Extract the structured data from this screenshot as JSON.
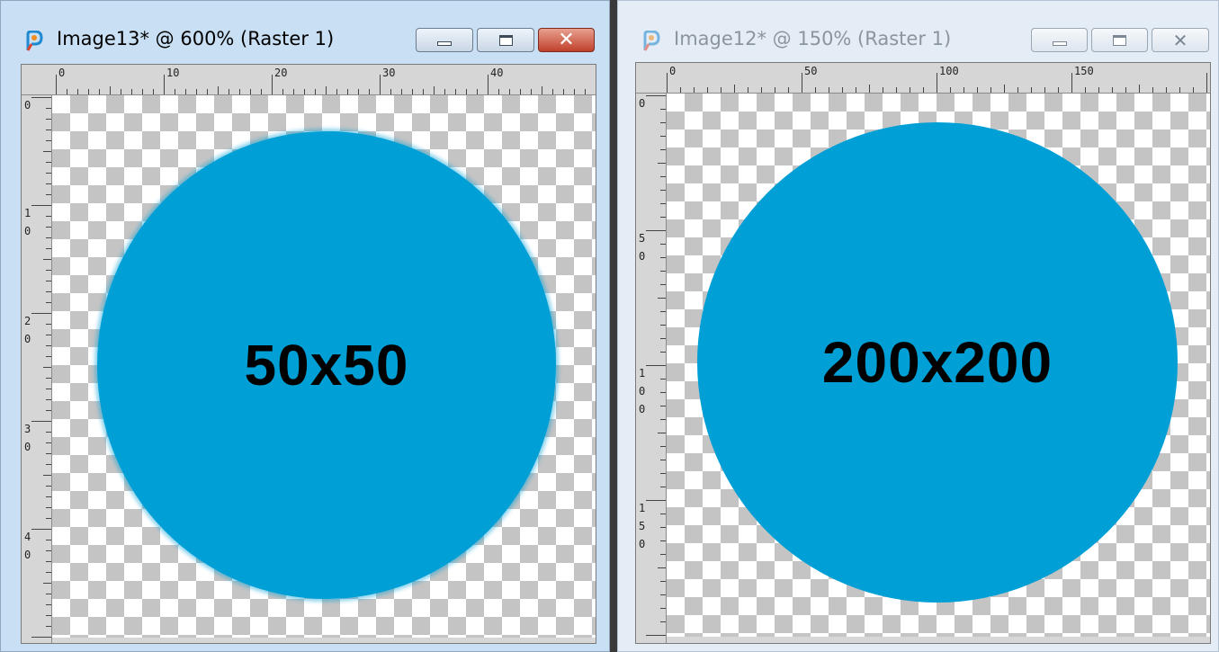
{
  "windows": [
    {
      "id": "left",
      "title": "Image13* @ 600% (Raster 1)",
      "active": true,
      "app_icon": "paintshop-pro-icon",
      "controls": {
        "minimize": "minimize-icon",
        "maximize": "maximize-icon",
        "close": "close-icon"
      },
      "h_ruler_labels": [
        "0",
        "10",
        "20",
        "30",
        "40"
      ],
      "v_ruler_labels": [
        [
          "0"
        ],
        [
          "1",
          "0"
        ],
        [
          "2",
          "0"
        ],
        [
          "3",
          "0"
        ],
        [
          "4",
          "0"
        ]
      ],
      "canvas_label": "50x50",
      "colors": {
        "circle": "#009fd6",
        "titlebar": "#c9dff3",
        "close_button": "#c0412c"
      }
    },
    {
      "id": "right",
      "title": "Image12* @ 150% (Raster 1)",
      "active": false,
      "app_icon": "paintshop-pro-icon",
      "controls": {
        "minimize": "minimize-icon",
        "maximize": "maximize-icon",
        "close": "close-icon"
      },
      "h_ruler_labels": [
        "0",
        "50",
        "100",
        "150"
      ],
      "v_ruler_labels": [
        [
          "0"
        ],
        [
          "5",
          "0"
        ],
        [
          "1",
          "0",
          "0"
        ],
        [
          "1",
          "5",
          "0"
        ]
      ],
      "canvas_label": "200x200",
      "colors": {
        "circle": "#009fd6",
        "titlebar": "#e4ecf5"
      }
    }
  ]
}
